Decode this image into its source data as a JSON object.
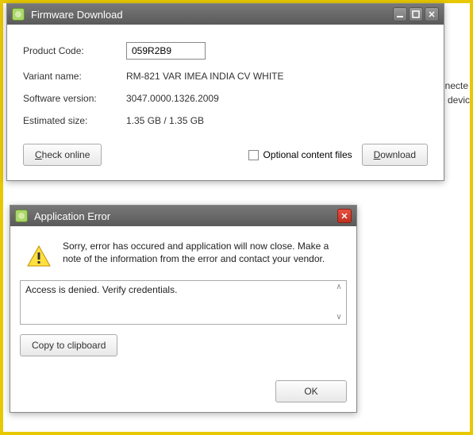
{
  "background": {
    "line1": "nnecte",
    "line2": "e devic"
  },
  "firmware": {
    "title": "Firmware Download",
    "fields": {
      "product_code_label": "Product Code:",
      "product_code_value": "059R2B9",
      "variant_label": "Variant name:",
      "variant_value": "RM-821 VAR IMEA INDIA CV WHITE",
      "software_label": "Software version:",
      "software_value": "3047.0000.1326.2009",
      "size_label": "Estimated size:",
      "size_value": "1.35 GB / 1.35 GB"
    },
    "buttons": {
      "check_online": "Check online",
      "optional_files": "Optional content files",
      "download": "Download"
    }
  },
  "error": {
    "title": "Application Error",
    "message": "Sorry, error has occured and application will now close. Make a note of the information from the error and contact your vendor.",
    "detail": "Access is denied. Verify credentials.",
    "copy": "Copy to clipboard",
    "ok": "OK"
  }
}
